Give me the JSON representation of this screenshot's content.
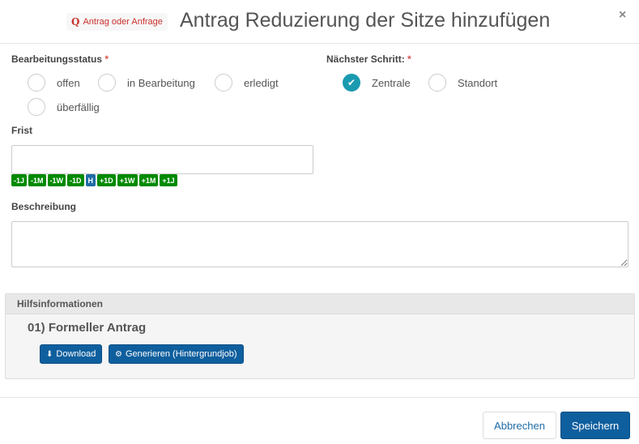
{
  "header": {
    "badge_icon": "Q",
    "badge_label": "Antrag oder Anfrage",
    "title": "Antrag Reduzierung der Sitze hinzufügen",
    "close": "×"
  },
  "status": {
    "label": "Bearbeitungsstatus",
    "required": "*",
    "options": [
      {
        "label": "offen",
        "checked": false
      },
      {
        "label": "in Bearbeitung",
        "checked": false
      },
      {
        "label": "erledigt",
        "checked": false
      },
      {
        "label": "überfällig",
        "checked": false
      }
    ]
  },
  "next_step": {
    "label": "Nächster Schritt:",
    "required": "*",
    "options": [
      {
        "label": "Zentrale",
        "checked": true
      },
      {
        "label": "Standort",
        "checked": false
      }
    ]
  },
  "deadline": {
    "label": "Frist",
    "value": "",
    "quick_buttons": [
      "-1J",
      "-1M",
      "-1W",
      "-1D",
      "H",
      "+1D",
      "+1W",
      "+1M",
      "+1J"
    ]
  },
  "description": {
    "label": "Beschreibung",
    "value": ""
  },
  "help_panel": {
    "heading": "Hilfsinformationen",
    "item_title": "01) Formeller Antrag",
    "download_label": "Download",
    "generate_label": "Generieren (Hintergrundjob)"
  },
  "footer": {
    "cancel_label": "Abbrechen",
    "save_label": "Speichern"
  },
  "colors": {
    "accent": "#1a9ab0",
    "primary": "#0f5f9e",
    "quick_green": "#008a00",
    "required": "#d9534f"
  }
}
